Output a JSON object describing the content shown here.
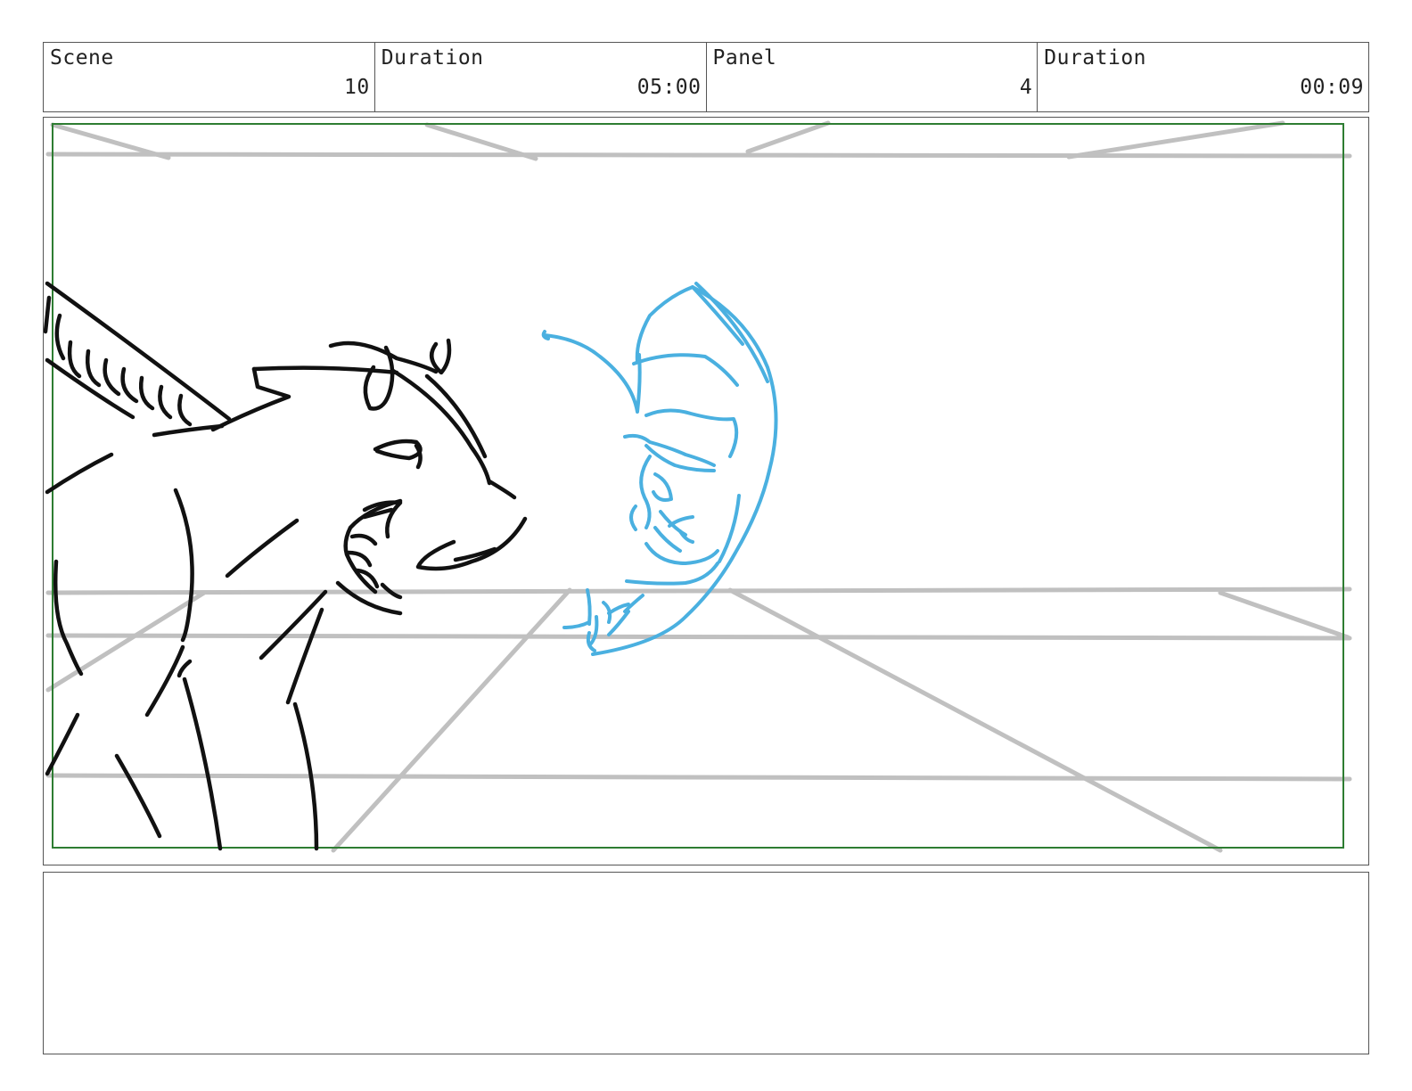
{
  "header": {
    "cells": [
      {
        "label": "Scene",
        "value": "10"
      },
      {
        "label": "Duration",
        "value": "05:00"
      },
      {
        "label": "Panel",
        "value": "4"
      },
      {
        "label": "Duration",
        "value": "00:09"
      }
    ]
  },
  "panel": {
    "safe_frame_color": "#2e7d32",
    "guide_line_color": "#c0c0c0",
    "character_left_color": "#111111",
    "character_right_color": "#4ab0e0"
  },
  "notes": {
    "text": ""
  }
}
